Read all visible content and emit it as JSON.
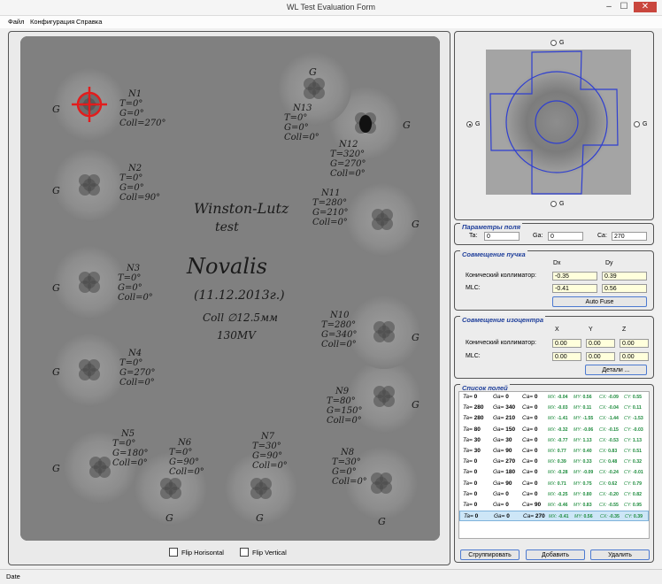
{
  "window": {
    "title": "WL Test Evaluation Form",
    "min": "–",
    "max": "☐",
    "close": "✕"
  },
  "menu": [
    "Файл",
    "Конфигурация",
    "Справка"
  ],
  "film": {
    "notes": [
      {
        "id": "n1",
        "lines": [
          "N1",
          "T=0°",
          "G=0°",
          "Coll=270°"
        ]
      },
      {
        "id": "n2",
        "lines": [
          "N2",
          "T=0°",
          "G=0°",
          "Coll=90°"
        ]
      },
      {
        "id": "n3",
        "lines": [
          "N3",
          "T=0°",
          "G=0°",
          "Coll=0°"
        ]
      },
      {
        "id": "n4",
        "lines": [
          "N4",
          "T=0°",
          "G=270°",
          "Coll=0°"
        ]
      },
      {
        "id": "n5",
        "lines": [
          "N5",
          "T=0°",
          "G=180°",
          "Coll=0°"
        ]
      },
      {
        "id": "n6",
        "lines": [
          "N6",
          "T=0°",
          "G=90°",
          "Coll=0°"
        ]
      },
      {
        "id": "n7",
        "lines": [
          "N7",
          "T=30°",
          "G=90°",
          "Coll=0°"
        ]
      },
      {
        "id": "n8",
        "lines": [
          "N8",
          "T=30°",
          "G=0°",
          "Coll=0°"
        ]
      },
      {
        "id": "n9",
        "lines": [
          "N9",
          "T=80°",
          "G=150°",
          "Coll=0°"
        ]
      },
      {
        "id": "n10",
        "lines": [
          "N10",
          "T=280°",
          "G=340°",
          "Coll=0°"
        ]
      },
      {
        "id": "n11",
        "lines": [
          "N11",
          "T=280°",
          "G=210°",
          "Coll=0°"
        ]
      },
      {
        "id": "n12",
        "lines": [
          "N12",
          "T=320°",
          "G=270°",
          "Coll=0°"
        ]
      },
      {
        "id": "n13",
        "lines": [
          "N13",
          "T=0°",
          "G=0°",
          "Coll=0°"
        ]
      }
    ],
    "center_lines": [
      "Winston-Lutz",
      "test",
      "Novalis",
      "(11.12.2013г.)",
      "Coll ∅12.5мм",
      "130MV"
    ],
    "g_mark": "G"
  },
  "flip_horizontal": "Flip Horisontal",
  "flip_vertical": "Flip Vertical",
  "preview": {
    "radio_top": "G",
    "radio_left": "G",
    "radio_right": "G",
    "radio_bottom": "G",
    "selected": "left"
  },
  "field_params": {
    "title": "Параметры поля",
    "ta_label": "Ta:",
    "ta": "0",
    "ga_label": "Ga:",
    "ga": "0",
    "ca_label": "Ca:",
    "ca": "270"
  },
  "beam": {
    "title": "Совмещение пучка",
    "dx_head": "Dx",
    "dy_head": "Dy",
    "cone_label": "Конический коллиматор:",
    "cone_dx": "-0.35",
    "cone_dy": "0.39",
    "mlc_label": "MLC:",
    "mlc_dx": "-0.41",
    "mlc_dy": "0.56",
    "button": "Auto Fuse"
  },
  "iso": {
    "title": "Совмещение изоцентра",
    "x_head": "X",
    "y_head": "Y",
    "z_head": "Z",
    "cone_label": "Конический коллиматор:",
    "cone_x": "0.00",
    "cone_y": "0.00",
    "cone_z": "0.00",
    "mlc_label": "MLC:",
    "mlc_x": "0.00",
    "mlc_y": "0.00",
    "mlc_z": "0.00",
    "button": "Детали ..."
  },
  "fields": {
    "title": "Список полей",
    "rows": [
      {
        "ta": "0",
        "ga": "0",
        "ca": "0",
        "mx": "-0.04",
        "my": "0.56",
        "cx": "-0.09",
        "cy": "0.55"
      },
      {
        "ta": "280",
        "ga": "340",
        "ca": "0",
        "mx": "-0.03",
        "my": "0.11",
        "cx": "-0.04",
        "cy": "0.11"
      },
      {
        "ta": "280",
        "ga": "210",
        "ca": "0",
        "mx": "-1.41",
        "my": "-1.55",
        "cx": "-1.44",
        "cy": "-1.53"
      },
      {
        "ta": "80",
        "ga": "150",
        "ca": "0",
        "mx": "-0.32",
        "my": "-0.06",
        "cx": "-0.15",
        "cy": "-0.03"
      },
      {
        "ta": "30",
        "ga": "30",
        "ca": "0",
        "mx": "-0.77",
        "my": "1.13",
        "cx": "-0.53",
        "cy": "1.13"
      },
      {
        "ta": "30",
        "ga": "90",
        "ca": "0",
        "mx": "0.77",
        "my": "0.40",
        "cx": "0.83",
        "cy": "0.51"
      },
      {
        "ta": "0",
        "ga": "270",
        "ca": "0",
        "mx": "0.39",
        "my": "0.33",
        "cx": "0.48",
        "cy": "0.32"
      },
      {
        "ta": "0",
        "ga": "180",
        "ca": "0",
        "mx": "-0.28",
        "my": "-0.09",
        "cx": "-0.24",
        "cy": "-0.01"
      },
      {
        "ta": "0",
        "ga": "90",
        "ca": "0",
        "mx": "0.71",
        "my": "0.75",
        "cx": "0.62",
        "cy": "0.79"
      },
      {
        "ta": "0",
        "ga": "0",
        "ca": "0",
        "mx": "-0.25",
        "my": "0.80",
        "cx": "-0.20",
        "cy": "0.82"
      },
      {
        "ta": "0",
        "ga": "0",
        "ca": "90",
        "mx": "-0.46",
        "my": "0.83",
        "cx": "-0.55",
        "cy": "0.95"
      },
      {
        "ta": "0",
        "ga": "0",
        "ca": "270",
        "mx": "-0.41",
        "my": "0.56",
        "cx": "-0.35",
        "cy": "0.39"
      }
    ],
    "selected": 11,
    "ta_lbl": "Ta=",
    "ga_lbl": "Ga=",
    "ca_lbl": "Ca=",
    "mx_lbl": "MX:",
    "my_lbl": "MY:",
    "cx_lbl": "CX:",
    "cy_lbl": "CY:",
    "group_button": "Сгруппировать",
    "add_button": "Добавить",
    "delete_button": "Удалить"
  },
  "status": "Date"
}
